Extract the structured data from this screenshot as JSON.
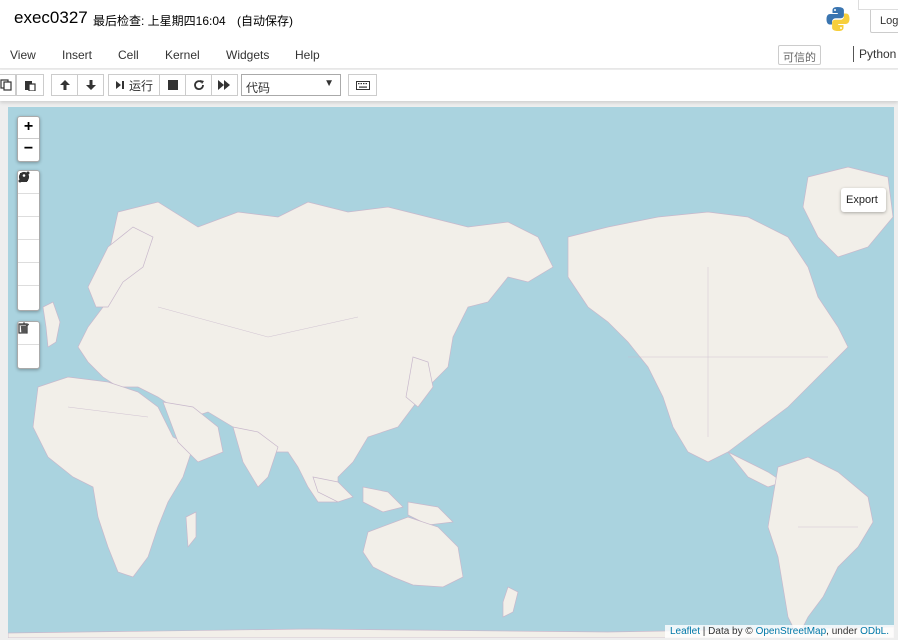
{
  "header": {
    "notebook_name": "exec0327",
    "checkpoint_text": "最后检查: 上星期四16:04",
    "autosave_text": "(自动保存)",
    "logout_label": "Log"
  },
  "menubar": {
    "items": [
      "View",
      "Insert",
      "Cell",
      "Kernel",
      "Widgets",
      "Help"
    ],
    "trusted_label": "可信的",
    "kernel_label": "Python"
  },
  "toolbar": {
    "run_label": "运行",
    "cell_type": "代码"
  },
  "map": {
    "export_label": "Export",
    "attribution": {
      "leaflet": "Leaflet",
      "data_by": "| Data by ©",
      "osm": "OpenStreetMap",
      "under": ", under",
      "odbl": "ODbL."
    },
    "zoom_in": "+",
    "zoom_out": "−"
  },
  "colors": {
    "ocean": "#aad3df",
    "land": "#f2efe9",
    "border": "#c8b8cc",
    "link": "#0078a8"
  }
}
